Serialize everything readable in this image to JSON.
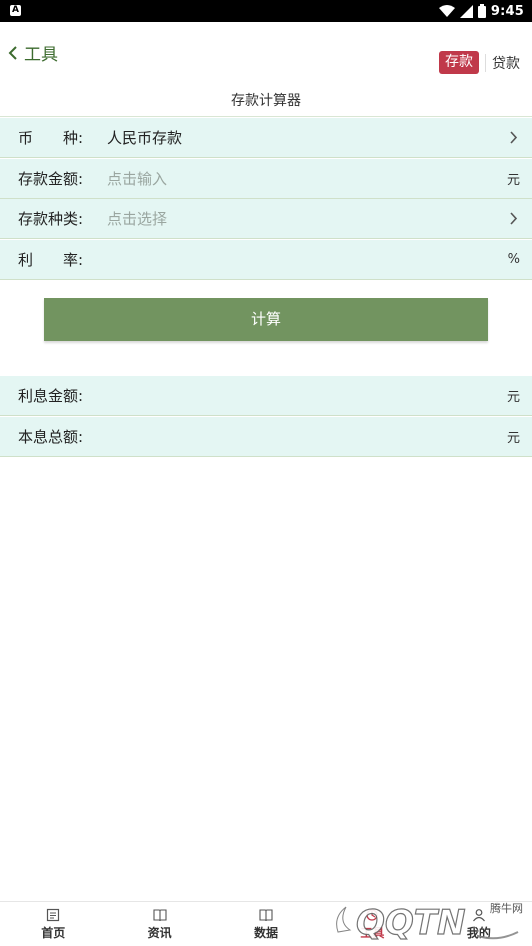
{
  "status_bar": {
    "left_icon": "A",
    "time": "9:45"
  },
  "header": {
    "back_label": "工具",
    "mode_active": "存款",
    "mode_inactive": "贷款",
    "title": "存款计算器"
  },
  "form": {
    "currency": {
      "label": "币　　种:",
      "value": "人民币存款"
    },
    "amount": {
      "label": "存款金额:",
      "placeholder": "点击输入",
      "unit": "元"
    },
    "type": {
      "label": "存款种类:",
      "placeholder": "点击选择"
    },
    "rate": {
      "label": "利　　率:",
      "unit": "%"
    }
  },
  "calc_button": "计算",
  "results": {
    "interest": {
      "label": "利息金额:",
      "unit": "元"
    },
    "total": {
      "label": "本息总额:",
      "unit": "元"
    }
  },
  "bottom_nav": [
    {
      "label": "首页",
      "icon": "news-icon"
    },
    {
      "label": "资讯",
      "icon": "book-icon"
    },
    {
      "label": "数据",
      "icon": "book-icon"
    },
    {
      "label": "工具",
      "icon": "tool-icon"
    },
    {
      "label": "我的",
      "icon": "user-icon"
    }
  ],
  "watermark": {
    "text": "腾牛网",
    "logo": "QQTN"
  },
  "colors": {
    "accent_green": "#3c6b2e",
    "button_green": "#729460",
    "active_red": "#c0394a",
    "row_bg": "#e4f6f3"
  }
}
